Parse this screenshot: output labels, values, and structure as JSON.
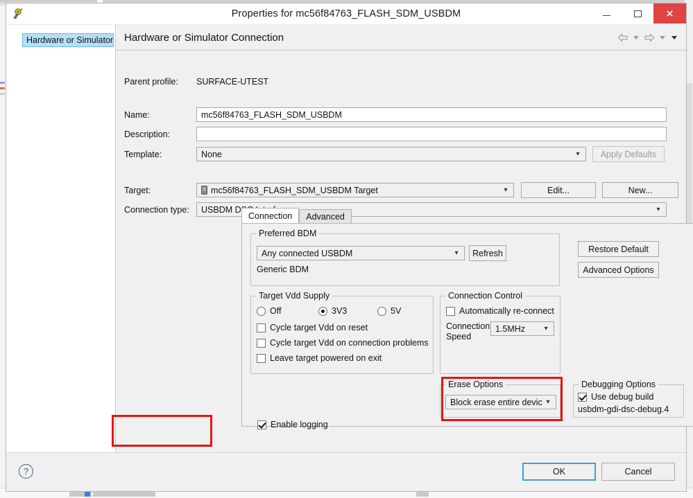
{
  "window": {
    "title": "Properties for mc56f84763_FLASH_SDM_USBDM",
    "icon": "app-icon",
    "minimize_label": "Minimize",
    "maximize_label": "Maximize",
    "close_label": "✕"
  },
  "sidebar": {
    "items": [
      {
        "label": "Hardware or Simulator Connection",
        "selected": true
      }
    ]
  },
  "pane": {
    "title": "Hardware or Simulator Connection",
    "nav": {
      "back_label": "Back",
      "forward_label": "Forward",
      "menu_label": "View Menu"
    }
  },
  "form": {
    "parent_profile_label": "Parent profile:",
    "parent_profile_value": "SURFACE-UTEST",
    "name_label": "Name:",
    "name_value": "mc56f84763_FLASH_SDM_USBDM",
    "description_label": "Description:",
    "description_value": "",
    "description_placeholder": "",
    "template_label": "Template:",
    "template_value": "None",
    "apply_defaults_label": "Apply Defaults",
    "target_label": "Target:",
    "target_value": "mc56f84763_FLASH_SDM_USBDM Target",
    "target_icon": "device-chip-icon",
    "edit_label": "Edit...",
    "new_label": "New...",
    "connection_type_label": "Connection type:",
    "connection_type_value": "USBDM DSC Interface"
  },
  "tabs": [
    {
      "label": "Connection",
      "active": true
    },
    {
      "label": "Advanced",
      "active": false
    }
  ],
  "connection_tab": {
    "preferred_bdm": {
      "title": "Preferred BDM",
      "value": "Any connected USBDM",
      "refresh_label": "Refresh",
      "status_text": "Generic BDM"
    },
    "restore_default_label": "Restore Default",
    "advanced_options_label": "Advanced Options",
    "target_vdd": {
      "title": "Target Vdd Supply",
      "radios": [
        {
          "label": "Off",
          "checked": false
        },
        {
          "label": "3V3",
          "checked": true
        },
        {
          "label": "5V",
          "checked": false
        }
      ],
      "checks": [
        {
          "label": "Cycle target Vdd on reset",
          "checked": false
        },
        {
          "label": "Cycle target Vdd on connection problems",
          "checked": false
        },
        {
          "label": "Leave target powered on exit",
          "checked": false
        }
      ]
    },
    "connection_control": {
      "title": "Connection Control",
      "auto_reconnect": {
        "label": "Automatically re-connect",
        "checked": false
      },
      "speed_label_line1": "Connection",
      "speed_label_line2": "Speed",
      "speed_value": "1.5MHz"
    },
    "erase_options": {
      "title": "Erase Options",
      "value": "Block erase entire device"
    },
    "debugging_options": {
      "title": "Debugging Options",
      "use_debug_build": {
        "label": "Use debug build",
        "checked": true
      },
      "build_name": "usbdm-gdi-dsc-debug.4",
      "highlighted": true
    },
    "enable_logging": {
      "label": "Enable logging",
      "checked": true,
      "highlighted": true
    }
  },
  "footer": {
    "help_label": "?",
    "ok_label": "OK",
    "cancel_label": "Cancel"
  },
  "colors": {
    "highlight_red": "#e81313",
    "selection_blue": "#b5e0f7",
    "close_red": "#e04343",
    "focus_blue": "#3f9be0"
  }
}
